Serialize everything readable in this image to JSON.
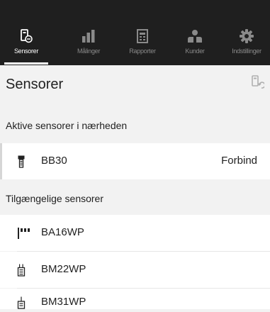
{
  "nav": {
    "tabs": [
      {
        "label": "Sensorer",
        "icon": "sensor-device-icon",
        "active": true
      },
      {
        "label": "Målinger",
        "icon": "bar-chart-icon",
        "active": false
      },
      {
        "label": "Rapporter",
        "icon": "report-icon",
        "active": false
      },
      {
        "label": "Kunder",
        "icon": "customers-icon",
        "active": false
      },
      {
        "label": "Indstillinger",
        "icon": "gear-icon",
        "active": false
      }
    ]
  },
  "page": {
    "title": "Sensorer",
    "refresh_icon": "sensor-refresh-icon"
  },
  "nearby": {
    "heading": "Aktive sensorer i nærheden",
    "items": [
      {
        "name": "BB30",
        "action": "Forbind",
        "icon": "battery-sensor-icon"
      }
    ]
  },
  "available": {
    "heading": "Tilgængelige sensorer",
    "items": [
      {
        "name": "BA16WP",
        "icon": "probe-sensor-icon"
      },
      {
        "name": "BM22WP",
        "icon": "pin-sensor-icon"
      },
      {
        "name": "BM31WP",
        "icon": "antenna-sensor-icon"
      }
    ]
  },
  "colors": {
    "topbar": "#1f1f1f",
    "background": "#f2f2f2",
    "row": "#ffffff",
    "inactive_tab": "#8a8a8a",
    "active_tab": "#ffffff"
  }
}
